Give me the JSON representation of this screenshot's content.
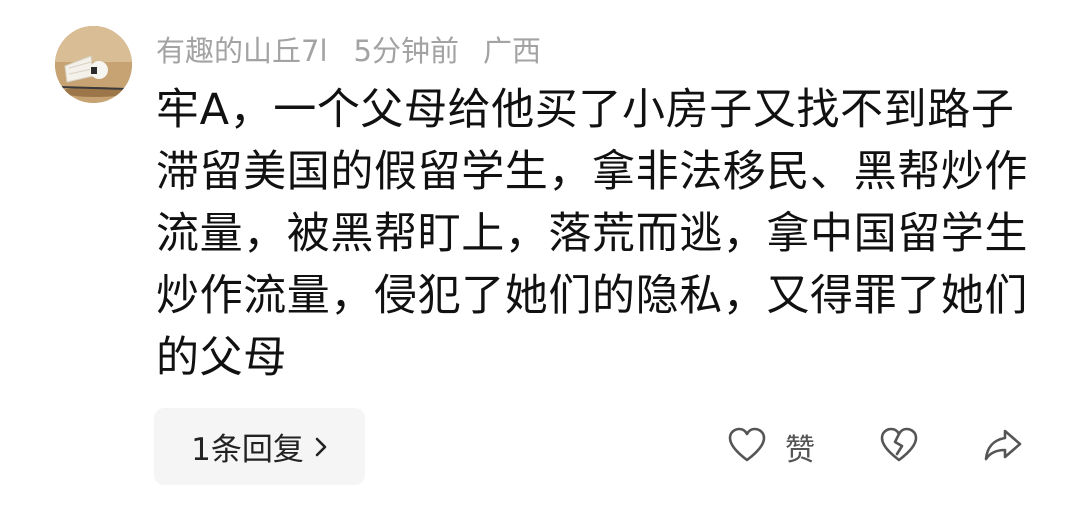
{
  "comment": {
    "username": "有趣的山丘7l",
    "time": "5分钟前",
    "location": "广西",
    "text": "牢A，一个父母给他买了小房子又找不到路子滞留美国的假留学生，拿非法移民、黑帮炒作流量，被黑帮盯上，落荒而逃，拿中国留学生炒作流量，侵犯了她们的隐私，又得罪了她们的父母",
    "reply_label": "1条回复",
    "like_label": "赞"
  },
  "icons": {
    "avatar": "badminton-shuttlecock-avatar",
    "reply_chevron": "chevron-right-icon",
    "like": "heart-outline-icon",
    "dislike": "broken-heart-icon",
    "share": "share-arrow-icon"
  },
  "colors": {
    "meta_text": "#a3a3a3",
    "body_text": "#111111",
    "reply_bg": "#f5f5f5",
    "icon_stroke": "#555555"
  }
}
